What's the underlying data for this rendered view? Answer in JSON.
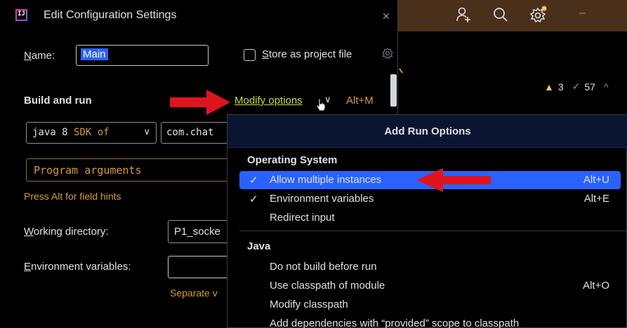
{
  "dialog": {
    "title": "Edit Configuration Settings",
    "close_icon": "close-icon",
    "name_label_mnemonic": "N",
    "name_label_rest": "ame:",
    "name_value": "Main",
    "store_label_mnemonic": "S",
    "store_label_rest": "tore as project file",
    "build_section": "Build and run",
    "modify_options": "Modify options",
    "modify_shortcut": "Alt+M",
    "jdk_prefix": "java 8 ",
    "jdk_sdk": "SDK of",
    "main_class": "com.chat",
    "program_args_placeholder": "Program arguments",
    "field_hint": "Press Alt for field hints",
    "workdir_label_mnemonic": "W",
    "workdir_label_rest": "orking directory:",
    "workdir_value": "P1_socke",
    "env_label_mnemonic": "E",
    "env_label_rest": "nvironment variables:",
    "env_value": "",
    "separate_hint": "Separate v"
  },
  "popup": {
    "title": "Add Run Options",
    "groups": [
      {
        "label": "Operating System",
        "items": [
          {
            "label": "Allow multiple instances",
            "checked": true,
            "shortcut": "Alt+U",
            "selected": true
          },
          {
            "label": "Environment variables",
            "checked": true,
            "shortcut": "Alt+E",
            "selected": false
          },
          {
            "label": "Redirect input",
            "checked": false,
            "shortcut": "",
            "selected": false
          }
        ]
      },
      {
        "label": "Java",
        "items": [
          {
            "label": "Do not build before run",
            "checked": false,
            "shortcut": "",
            "selected": false
          },
          {
            "label": "Use classpath of module",
            "checked": false,
            "shortcut": "Alt+O",
            "selected": false
          },
          {
            "label": "Modify classpath",
            "checked": false,
            "shortcut": "",
            "selected": false
          },
          {
            "label": "Add dependencies with “provided” scope to classpath",
            "checked": false,
            "shortcut": "",
            "selected": false
          }
        ]
      }
    ],
    "check_glyph": "✓"
  },
  "ide": {
    "warnings": "3",
    "ok_count": "57",
    "toolbar_icons": [
      "add-user-icon",
      "search-icon",
      "settings-icon"
    ]
  },
  "colors": {
    "accent": "#2962ff",
    "link": "#c3db43",
    "orange": "#d79b38",
    "toolbar_bg": "#4a2f1a",
    "arrow": "#e0141e"
  }
}
